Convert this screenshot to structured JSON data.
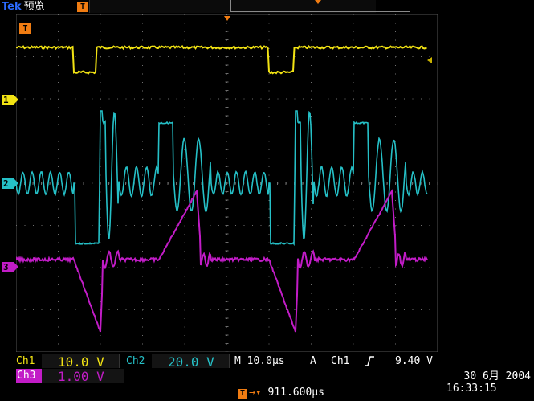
{
  "header": {
    "brand": "Tek",
    "mode": "预览",
    "trigger_marker": "T"
  },
  "graticule": {
    "trigger_marker": "T",
    "channels": [
      {
        "id": "1",
        "color": "#f2e313"
      },
      {
        "id": "2",
        "color": "#25c0c7"
      },
      {
        "id": "3",
        "color": "#c21cc7"
      }
    ]
  },
  "settings": {
    "ch1_label": "Ch1",
    "ch1_scale": "10.0 V",
    "ch2_label": "Ch2",
    "ch2_scale": "20.0 V",
    "ch3_label": "Ch3",
    "ch3_scale": "1.00 V",
    "timebase": "M 10.0μs",
    "trigger_mode": "A",
    "trigger_source": "Ch1",
    "trigger_slope_icon": "rising-edge-icon",
    "trigger_level": "9.40 V"
  },
  "status": {
    "date": "30 6月  2004",
    "time": "16:33:15",
    "position": "911.600μs",
    "position_marker": "T"
  },
  "colors": {
    "ch1": "#f2e313",
    "ch2": "#25c0c7",
    "ch3": "#c21cc7",
    "trigger": "#f07c12",
    "grid": "#6f6f6f"
  }
}
